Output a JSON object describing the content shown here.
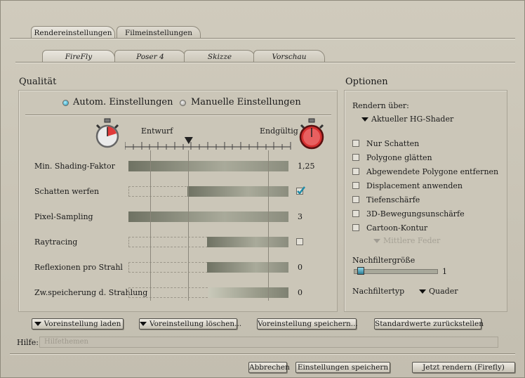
{
  "tabs": [
    "Rendereinstellungen",
    "Filmeinstellungen"
  ],
  "subtabs": [
    "FireFly",
    "Poser 4",
    "Skizze",
    "Vorschau"
  ],
  "quality": {
    "title": "Qualität",
    "auto_label": "Autom. Einstellungen",
    "manual_label": "Manuelle Einstellungen",
    "auto_selected": true,
    "draft_label": "Entwurf",
    "final_label": "Endgültig",
    "preset_position": 0.385,
    "rows": [
      {
        "label": "Min. Shading-Faktor",
        "value": "1,25",
        "fill_start": 0.0,
        "fill_end": 1.0,
        "kind": "text"
      },
      {
        "label": "Schatten werfen",
        "value": "",
        "fill_start": 0.37,
        "fill_end": 1.0,
        "kind": "check-on"
      },
      {
        "label": "Pixel-Sampling",
        "value": "3",
        "fill_start": 0.0,
        "fill_end": 1.0,
        "kind": "text"
      },
      {
        "label": "Raytracing",
        "value": "",
        "fill_start": 0.49,
        "fill_end": 1.0,
        "kind": "check-off"
      },
      {
        "label": "Reflexionen pro Strahl",
        "value": "0",
        "fill_start": 0.49,
        "fill_end": 1.0,
        "kind": "text"
      },
      {
        "label": "Zw.speicherung d. Strahlung",
        "value": "0",
        "fill_start": 0.5,
        "fill_end": 1.0,
        "kind": "text"
      }
    ]
  },
  "options": {
    "title": "Optionen",
    "render_via_label": "Rendern über:",
    "render_via_value": "Aktueller HG-Shader",
    "checkboxes": [
      "Nur Schatten",
      "Polygone glätten",
      "Abgewendete Polygone entfernen",
      "Displacement anwenden",
      "Tiefenschärfe",
      "3D-Bewegungsunschärfe",
      "Cartoon-Kontur"
    ],
    "cartoon_sub": "Mittlere Feder",
    "filter_size_label": "Nachfiltergröße",
    "filter_size_value": "1",
    "filter_type_label": "Nachfiltertyp",
    "filter_type_value": "Quader"
  },
  "preset_buttons": [
    "Voreinstellung laden",
    "Voreinstellung löschen...",
    "Voreinstellung speichern...",
    "Standardwerte zurückstellen"
  ],
  "help": {
    "label": "Hilfe:",
    "text": "Hilfethemen"
  },
  "footer_buttons": [
    "Abbrechen",
    "Einstellungen speichern",
    "Jetzt rendern (Firefly)"
  ]
}
